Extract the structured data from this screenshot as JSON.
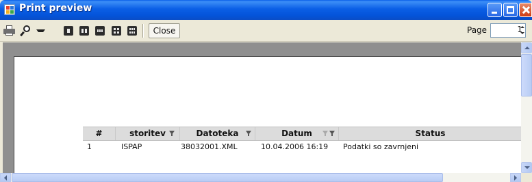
{
  "window": {
    "title": "Print preview"
  },
  "toolbar": {
    "print_icon": "printer-icon",
    "zoom_icon": "magnifier-icon",
    "page_layout_icons": [
      "one-page-icon",
      "two-pages-icon",
      "three-pages-icon",
      "four-pages-icon",
      "six-pages-icon"
    ],
    "close_label": "Close",
    "page_label": "Page",
    "page_value": "1"
  },
  "report": {
    "columns": [
      {
        "label": "#",
        "filter": false
      },
      {
        "label": "storitev",
        "filter": true
      },
      {
        "label": "Datoteka",
        "filter": true
      },
      {
        "label": "Datum",
        "filter": true,
        "sorted": true
      },
      {
        "label": "Status",
        "filter": false
      }
    ],
    "rows": [
      {
        "num": "1",
        "storitev": "ISPAP",
        "datoteka": "38032001.XML",
        "datum": "10.04.2006 16:19",
        "status": "Podatki so zavrnjeni"
      }
    ]
  },
  "colors": {
    "titlebar": "#0b5fe6",
    "toolbar_bg": "#ece9d8",
    "preview_bg": "#8f8f8f",
    "header_bg": "#dcdcdc"
  }
}
